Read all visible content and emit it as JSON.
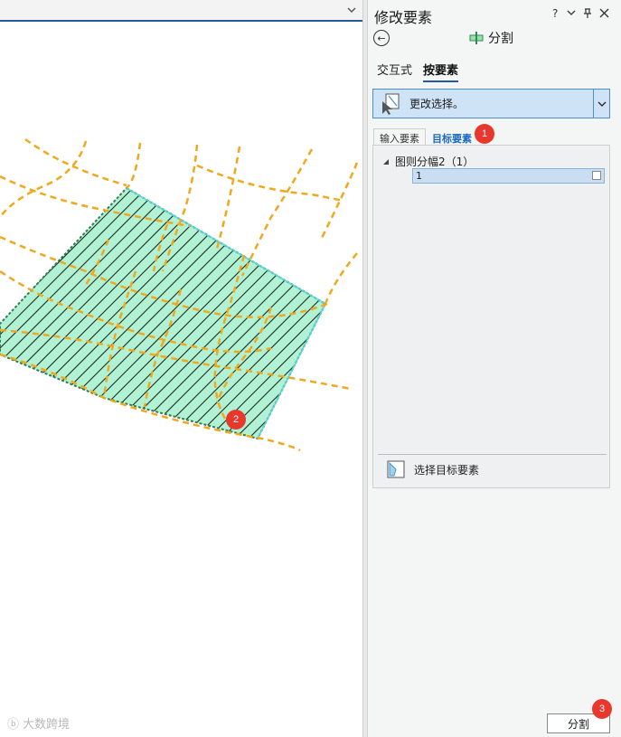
{
  "panel": {
    "title": "修改要素",
    "help_icon": "?",
    "menu_icon": "⌄",
    "pin_icon": "🖈",
    "close_icon": "✕",
    "tool_title": "分割",
    "tabs": [
      "交互式",
      "按要素"
    ],
    "active_tab": "按要素",
    "select_label": "更改选择。",
    "subtabs": [
      "输入要素",
      "目标要素"
    ],
    "active_subtab": "目标要素",
    "tree": {
      "node_label": "图则分幅2（1）",
      "row_value": "1"
    },
    "target_label": "选择目标要素",
    "split_button": "分割"
  },
  "badges": {
    "b1": "1",
    "b2": "2",
    "b3": "3"
  },
  "watermark": "大数跨境",
  "colors": {
    "accent": "#1f5c99",
    "polygon_fill": "#b2f2d4",
    "polygon_stroke": "#2e9e6e",
    "dashed_lines": "#f0a81c",
    "badge": "#e8372c"
  }
}
